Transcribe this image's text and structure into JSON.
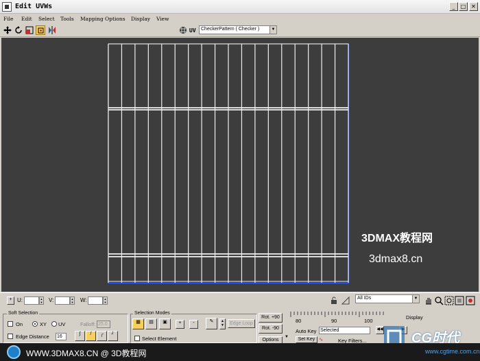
{
  "window": {
    "title": "Edit UVWs",
    "minimize": "_",
    "maximize": "□",
    "close": "✕"
  },
  "menu": [
    "File",
    "Edit",
    "Select",
    "Tools",
    "Mapping",
    "Options",
    "Display",
    "View"
  ],
  "toolbar": {
    "uv_label": "UV",
    "texture": "CheckerPattern ( Checker )"
  },
  "viewport": {
    "background": "#3d3d3d",
    "watermark_title": "3DMAX教程网",
    "watermark_url": "3dmax8.cn"
  },
  "coords": {
    "u_label": "U:",
    "v_label": "V:",
    "w_label": "W:",
    "u_value": "",
    "v_value": "",
    "w_value": "",
    "id_filter": "All IDs"
  },
  "soft_selection": {
    "title": "Soft Selection",
    "on_label": "On",
    "xy_label": "XY",
    "uv_label": "UV",
    "falloff_label": "Falloff:",
    "falloff_value": "25.0",
    "edge_distance_label": "Edge Distance",
    "edge_distance_value": "16"
  },
  "selection_modes": {
    "title": "Selection Modes",
    "plus": "+",
    "minus": "-",
    "edge_loop": "Edge Loop",
    "select_element": "Select Element"
  },
  "rotate": {
    "plus90": "Rot. +90",
    "minus90": "Rot. -90",
    "options": "Options"
  },
  "timeline": {
    "ticks": [
      "80",
      "90",
      "100"
    ]
  },
  "animation": {
    "auto_key": "Auto Key",
    "set_key": "Set Key",
    "selected": "Selected",
    "key_filters": "Key Filters...",
    "display": "Display"
  },
  "footer": {
    "text": "WWW.3DMAX8.CN @ 3D教程网",
    "cg_logo": "CG时代",
    "cg_url": "www.cgtime.com.cn"
  }
}
